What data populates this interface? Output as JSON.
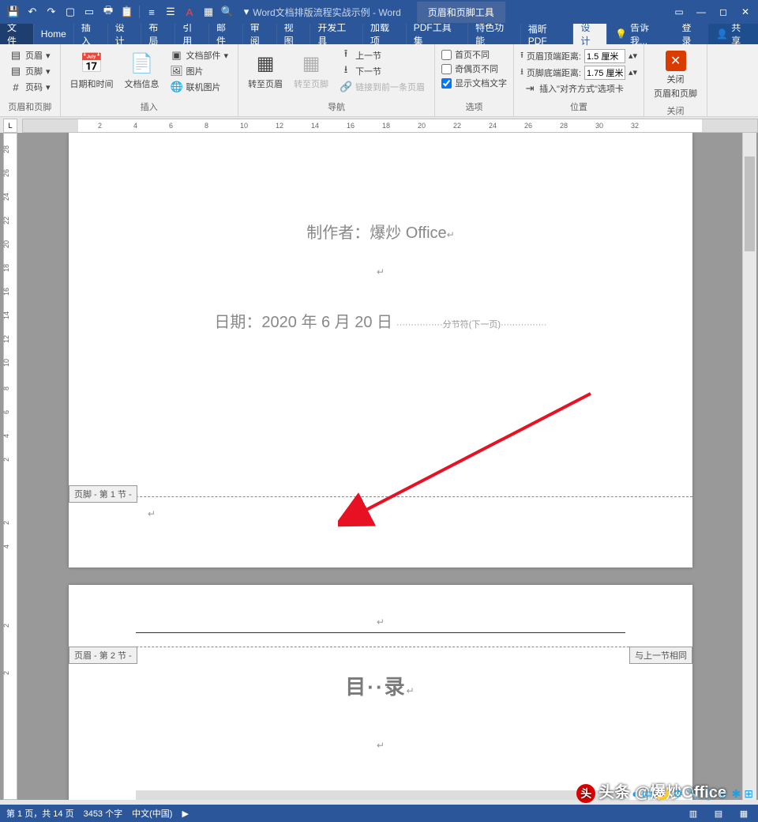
{
  "title": "Word文档排版流程实战示例 - Word",
  "context_tab": "页眉和页脚工具",
  "win": {
    "login": "登录",
    "share": "共享",
    "tell_me": "告诉我..."
  },
  "tabs": [
    "文件",
    "Home",
    "插入",
    "设计",
    "布局",
    "引用",
    "邮件",
    "审阅",
    "视图",
    "开发工具",
    "加载项",
    "PDF工具集",
    "特色功能",
    "福昕PDF"
  ],
  "active_tab": "设计",
  "ribbon": {
    "g1": {
      "header": "页眉",
      "footer": "页脚",
      "pagenum": "页码",
      "label": "页眉和页脚"
    },
    "g2": {
      "datetime": "日期和时间",
      "docinfo": "文档信息",
      "parts": "文档部件",
      "pic": "图片",
      "online": "联机图片",
      "label": "插入"
    },
    "g3": {
      "goto_h": "转至页眉",
      "goto_f": "转至页脚",
      "prev": "上一节",
      "next": "下一节",
      "link": "链接到前一条页眉",
      "label": "导航"
    },
    "g4": {
      "diff_first": "首页不同",
      "diff_odd": "奇偶页不同",
      "show_doc": "显示文档文字",
      "label": "选项"
    },
    "g5": {
      "top": "页眉顶端距离:",
      "bot": "页脚底端距离:",
      "align": "插入\"对齐方式\"选项卡",
      "top_v": "1.5 厘米",
      "bot_v": "1.75 厘米",
      "label": "位置"
    },
    "g6": {
      "close": "关闭",
      "close2": "页眉和页脚",
      "label": "关闭"
    }
  },
  "doc": {
    "author_line": "制作者：爆炒 Office",
    "date_line": "日期：2020 年 6 月 20 日",
    "section_break": "分节符(下一页)",
    "footer_tag1": "页脚 - 第 1 节 -",
    "header_tag2": "页眉 - 第 2 节 -",
    "same_as_prev": "与上一节相同",
    "toc": "目··录"
  },
  "status": {
    "page": "第 1 页，共 14 页",
    "words": "3453 个字",
    "lang": "中文(中国)"
  },
  "watermark": "头条 @爆炒Office"
}
